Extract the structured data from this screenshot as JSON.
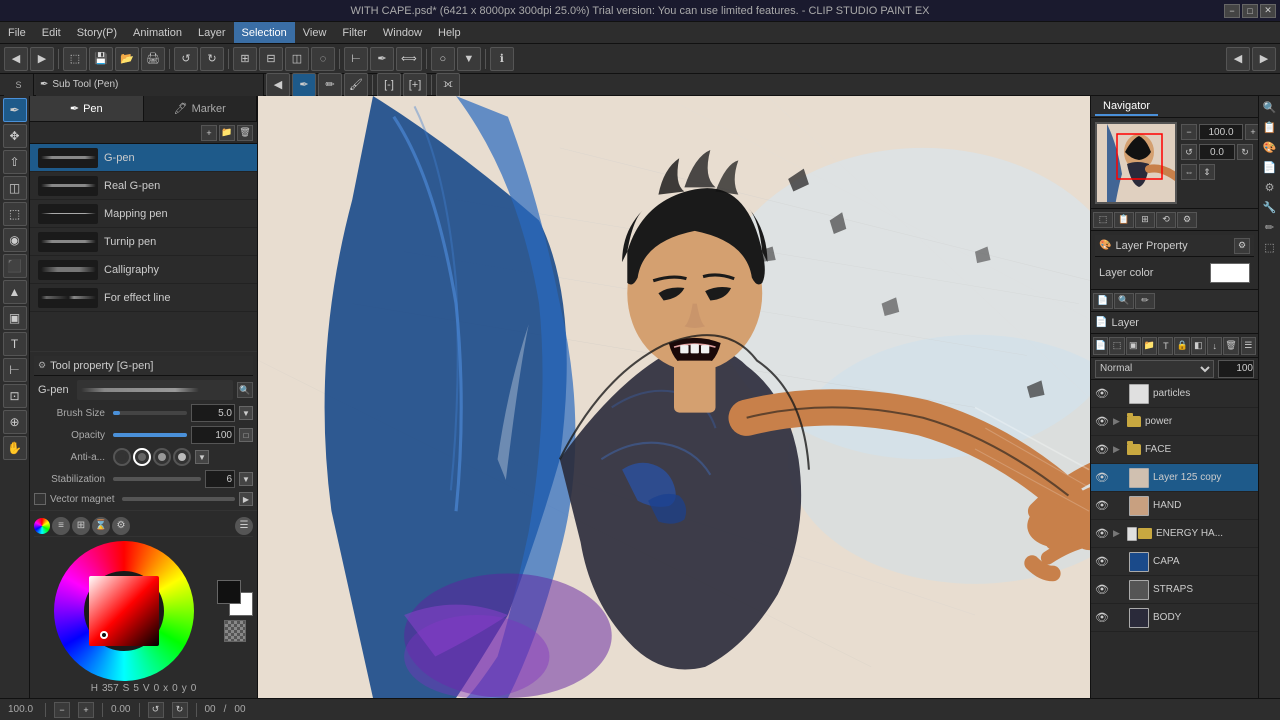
{
  "titlebar": {
    "title": "WITH CAPE.psd* (6421 x 8000px 300dpi 25.0%)  Trial version: You can use limited features. - CLIP STUDIO PAINT EX"
  },
  "menubar": {
    "items": [
      "File",
      "Edit",
      "Story(P)",
      "Animation",
      "Layer",
      "Selection",
      "View",
      "Filter",
      "Window",
      "Help"
    ]
  },
  "toolbar": {
    "sub_tool_label": "Sub Tool (Pen)"
  },
  "sub_tool": {
    "tabs": [
      "Pen",
      "Marker"
    ],
    "brushes": [
      {
        "name": "G-pen",
        "stroke_type": "medium"
      },
      {
        "name": "Real G-pen",
        "stroke_type": "medium"
      },
      {
        "name": "Mapping pen",
        "stroke_type": "thin"
      },
      {
        "name": "Turnip pen",
        "stroke_type": "medium"
      },
      {
        "name": "Calligraphy",
        "stroke_type": "thick"
      },
      {
        "name": "For effect line",
        "stroke_type": "effect"
      }
    ],
    "active_brush": "G-pen"
  },
  "tool_property": {
    "header": "Tool property [G-pen]",
    "brush_name": "G-pen",
    "brush_size_label": "Brush Size",
    "brush_size_value": "5.0",
    "opacity_label": "Opacity",
    "opacity_value": "100",
    "anti_alias_label": "Anti-a...",
    "stabilization_label": "Stabilization",
    "stabilization_value": "6",
    "vector_magnet_label": "Vector magnet"
  },
  "color_panel": {
    "hue": "357",
    "saturation": "5",
    "value": "0",
    "x": "0",
    "y": "0"
  },
  "navigator": {
    "tab": "Navigator",
    "zoom": "100.0",
    "rotation": "0.0"
  },
  "layer_property": {
    "header": "Layer Property",
    "layer_color_label": "Layer color"
  },
  "layer_panel": {
    "header": "Layer",
    "blend_mode": "Normal",
    "opacity": "100",
    "layers": [
      {
        "name": "particles",
        "type": "paint",
        "visible": true,
        "locked": false,
        "indent": 0
      },
      {
        "name": "power",
        "type": "folder",
        "visible": true,
        "locked": false,
        "indent": 0
      },
      {
        "name": "FACE",
        "type": "folder",
        "visible": true,
        "locked": false,
        "indent": 0
      },
      {
        "name": "Layer 125 copy",
        "type": "paint",
        "visible": true,
        "locked": false,
        "indent": 0,
        "active": true
      },
      {
        "name": "HAND",
        "type": "paint",
        "visible": true,
        "locked": false,
        "indent": 0
      },
      {
        "name": "ENERGY HA...",
        "type": "folder",
        "visible": true,
        "locked": false,
        "indent": 0
      },
      {
        "name": "CAPA",
        "type": "paint",
        "visible": true,
        "locked": false,
        "indent": 0
      },
      {
        "name": "STRAPS",
        "type": "paint",
        "visible": true,
        "locked": false,
        "indent": 0
      },
      {
        "name": "BODY",
        "type": "paint",
        "visible": true,
        "locked": false,
        "indent": 0
      }
    ]
  },
  "statusbar": {
    "zoom": "100.0",
    "position_x": "0",
    "position_y": "0",
    "rotation": "0.00"
  },
  "icons": {
    "eye": "👁",
    "lock": "🔒",
    "folder": "📁",
    "pen": "✒",
    "marker": "🖊",
    "search": "🔍",
    "gear": "⚙",
    "close": "✕",
    "expand": "▶",
    "collapse": "▼",
    "arrow_left": "◀",
    "arrow_right": "▶",
    "plus": "+",
    "minus": "−",
    "check": "✓",
    "rotate_left": "↺",
    "rotate_right": "↻",
    "flip_h": "⇔",
    "flip_v": "⇕",
    "link": "🔗",
    "grid": "▦",
    "move": "✥",
    "lasso": "⊃",
    "fill": "▲",
    "eraser": "◫",
    "eyedrop": "◉",
    "text": "T",
    "shape": "□",
    "hand": "✋",
    "zoom_tool": "⊕",
    "gradient": "▣"
  }
}
